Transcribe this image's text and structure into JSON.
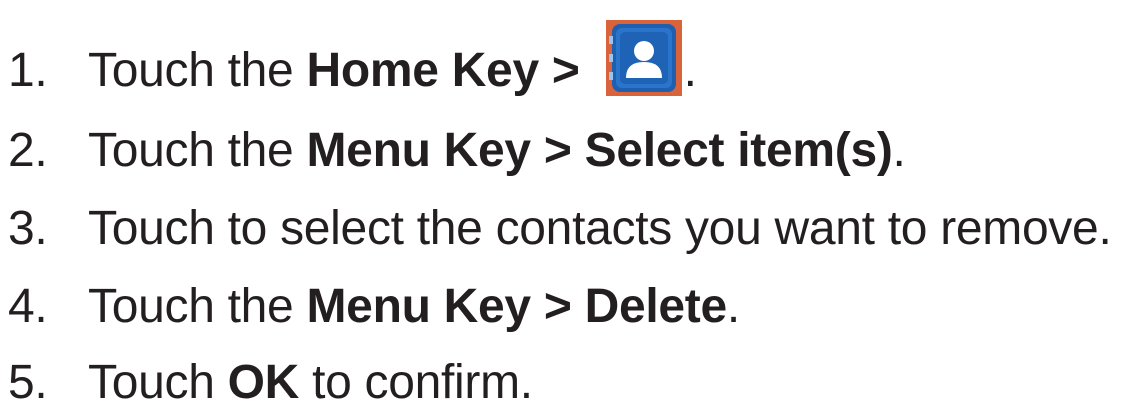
{
  "steps": [
    {
      "number": "1.",
      "text_a": "Touch the ",
      "bold_a": "Home Key >",
      "after_icon": ".",
      "icon": "contacts-app-icon"
    },
    {
      "number": "2.",
      "text_a": "Touch the ",
      "bold_a": "Menu Key > Select item(s)",
      "text_b": "."
    },
    {
      "number": "3.",
      "text_a": "Touch to select the contacts you want to remove."
    },
    {
      "number": "4.",
      "text_a": "Touch the ",
      "bold_a": "Menu Key > Delete",
      "text_b": "."
    },
    {
      "number": "5.",
      "text_a": "Touch ",
      "bold_a": "OK",
      "text_b": " to confirm."
    }
  ],
  "colors": {
    "text": "#231f20",
    "icon_blue": "#1f5fb0",
    "icon_border": "#d9643c"
  }
}
